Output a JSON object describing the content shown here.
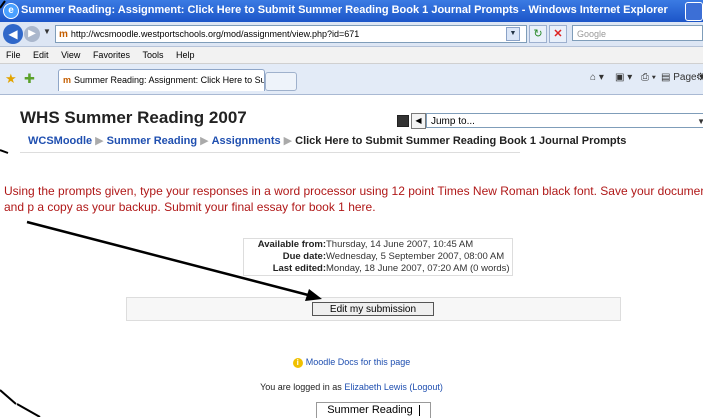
{
  "window": {
    "title": "Summer Reading: Assignment: Click Here to Submit Summer Reading Book 1 Journal Prompts - Windows Internet Explorer"
  },
  "browser": {
    "url": "http://wcsmoodle.westportschools.org/mod/assignment/view.php?id=671",
    "search_placeholder": "Google",
    "menu": [
      "File",
      "Edit",
      "View",
      "Favorites",
      "Tools",
      "Help"
    ],
    "tab_title": "Summer Reading: Assignment: Click Here to Submit Su...",
    "page_label": "Page"
  },
  "page": {
    "title": "WHS Summer Reading 2007",
    "jump_to": "Jump to...",
    "breadcrumb": {
      "items": [
        "WCSMoodle",
        "Summer Reading",
        "Assignments"
      ],
      "separator": "▶",
      "current": "Click Here to Submit Summer Reading Book 1 Journal Prompts"
    },
    "instructions": "Using the prompts given, type your responses in a word processor using 12 point Times New Roman black font. Save your document and p a copy as your backup. Submit your final essay for book 1 here.",
    "dates": [
      {
        "label": "Available from:",
        "value": "Thursday, 14 June 2007, 10:45 AM"
      },
      {
        "label": "Due date:",
        "value": "Wednesday, 5 September 2007, 08:00 AM"
      },
      {
        "label": "Last edited:",
        "value": "Monday, 18 June 2007, 07:20 AM (0 words)"
      }
    ],
    "edit_button": "Edit my submission",
    "docs_link": "Moodle Docs for this page",
    "login_prefix": "You are logged in as ",
    "login_user": "Elizabeth Lewis",
    "logout": "(Logout)",
    "footer_link": "Summer Reading"
  },
  "colors": {
    "instruction_text": "#b01818",
    "link": "#1f4fb0"
  }
}
